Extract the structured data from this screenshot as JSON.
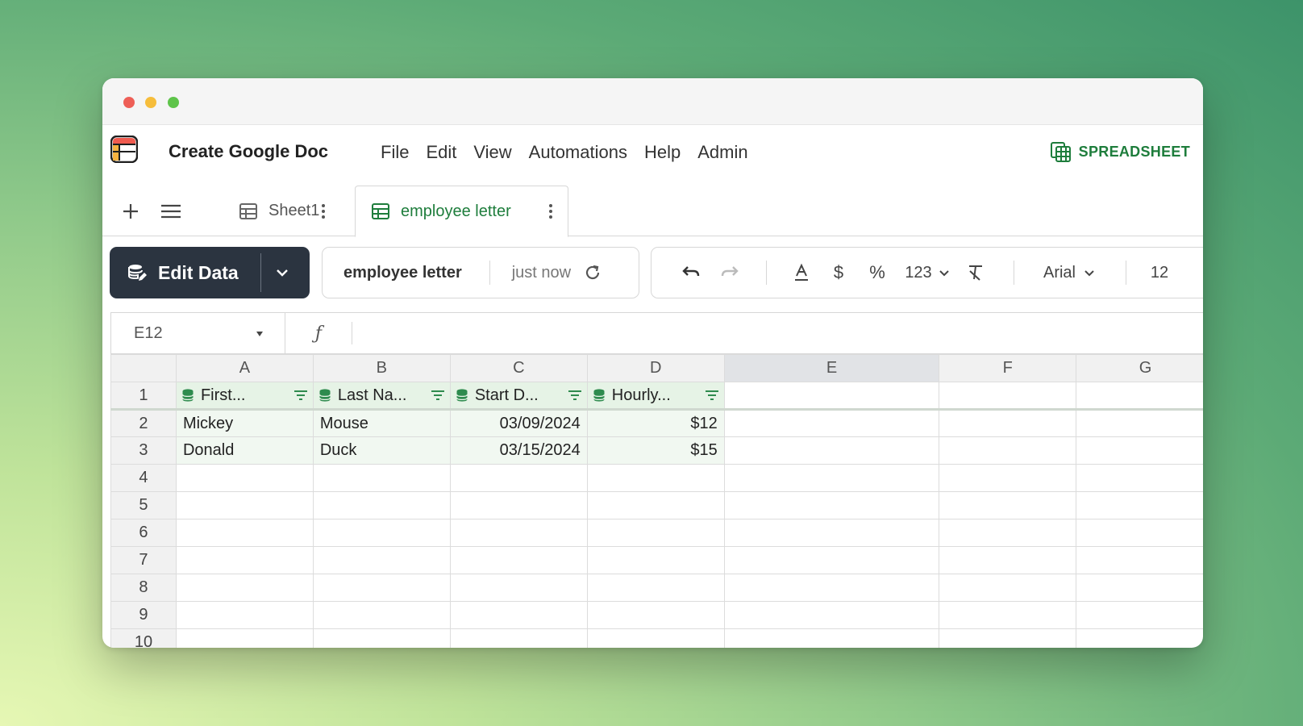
{
  "app": {
    "title": "Create Google Doc",
    "brand": "SPREADSHEET",
    "menu": [
      "File",
      "Edit",
      "View",
      "Automations",
      "Help",
      "Admin"
    ]
  },
  "tabs": [
    {
      "label": "Sheet1",
      "active": false
    },
    {
      "label": "employee letter",
      "active": true
    }
  ],
  "toolbar": {
    "edit_label": "Edit Data",
    "sheet_name": "employee letter",
    "saved_time": "just now",
    "number_format": "123",
    "font": "Arial",
    "font_size": "12"
  },
  "formula_bar": {
    "cell_ref": "E12",
    "fx_label": "ƒ",
    "value": ""
  },
  "grid": {
    "columns": [
      "A",
      "B",
      "C",
      "D",
      "E",
      "F",
      "G"
    ],
    "selected_column": "E",
    "headers": [
      "First...",
      "Last Na...",
      "Start D...",
      "Hourly..."
    ],
    "rows": [
      [
        "Mickey",
        "Mouse",
        "03/09/2024",
        "$12"
      ],
      [
        "Donald",
        "Duck",
        "03/15/2024",
        "$15"
      ]
    ],
    "row_numbers": [
      "1",
      "2",
      "3",
      "4",
      "5",
      "6",
      "7",
      "8",
      "9",
      "10"
    ]
  },
  "colors": {
    "accent": "#1e7d3c",
    "edit_button_bg": "#2b3440",
    "header_fill": "#e6f3e6",
    "data_fill": "#f1f8f1"
  }
}
